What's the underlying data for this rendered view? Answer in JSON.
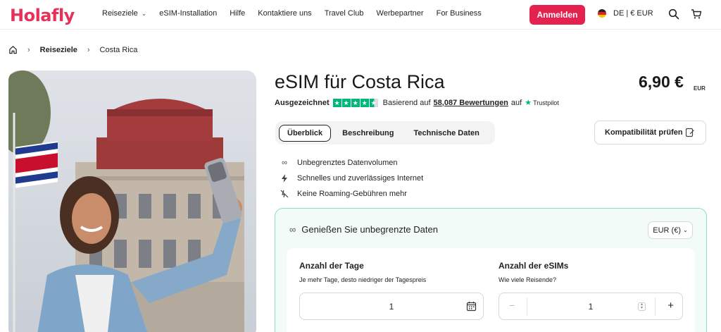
{
  "brand": {
    "name": "Holafly",
    "color": "#e6325a"
  },
  "nav": {
    "items": [
      {
        "label": "Reiseziele",
        "has_dropdown": true
      },
      {
        "label": "eSIM-Installation"
      },
      {
        "label": "Hilfe"
      },
      {
        "label": "Kontaktiere uns"
      },
      {
        "label": "Travel Club"
      },
      {
        "label": "Werbepartner"
      },
      {
        "label": "For Business"
      }
    ],
    "login_label": "Anmelden",
    "login_color": "#e5224f",
    "locale": "DE | € EUR",
    "icons": [
      "search-icon",
      "cart-icon"
    ]
  },
  "breadcrumb": {
    "home_icon": "home-icon",
    "items": [
      "Reiseziele",
      "Costa Rica"
    ]
  },
  "product": {
    "title": "eSIM für Costa Rica",
    "price": "6,90 €",
    "currency_unit": "EUR",
    "rating": {
      "label": "Ausgezeichnet",
      "stars": 4.5,
      "based_on": "Basierend auf",
      "reviews_link": "58,087 Bewertungen",
      "on": "auf",
      "provider": "Trustpilot",
      "star_color": "#00b67a"
    },
    "tabs": [
      {
        "label": "Überblick",
        "active": true
      },
      {
        "label": "Beschreibung",
        "active": false
      },
      {
        "label": "Technische Daten",
        "active": false
      }
    ],
    "compat_label": "Kompatibilität prüfen",
    "features": [
      {
        "icon": "infinity-icon",
        "text": "Unbegrenztes Datenvolumen"
      },
      {
        "icon": "lightning-icon",
        "text": "Schnelles und zuverlässiges Internet"
      },
      {
        "icon": "no-roaming-icon",
        "text": "Keine Roaming-Gebühren mehr"
      }
    ]
  },
  "plan": {
    "heading": "Genießen Sie unbegrenzte Daten",
    "currency_select": "EUR (€)",
    "border_color": "#86e0c4",
    "days": {
      "label": "Anzahl der Tage",
      "sub": "Je mehr Tage, desto niedriger der Tagespreis",
      "value": "1"
    },
    "esims": {
      "label": "Anzahl der eSIMs",
      "sub": "Wie viele Reisende?",
      "value": "1",
      "minus": "−",
      "plus": "+"
    }
  }
}
